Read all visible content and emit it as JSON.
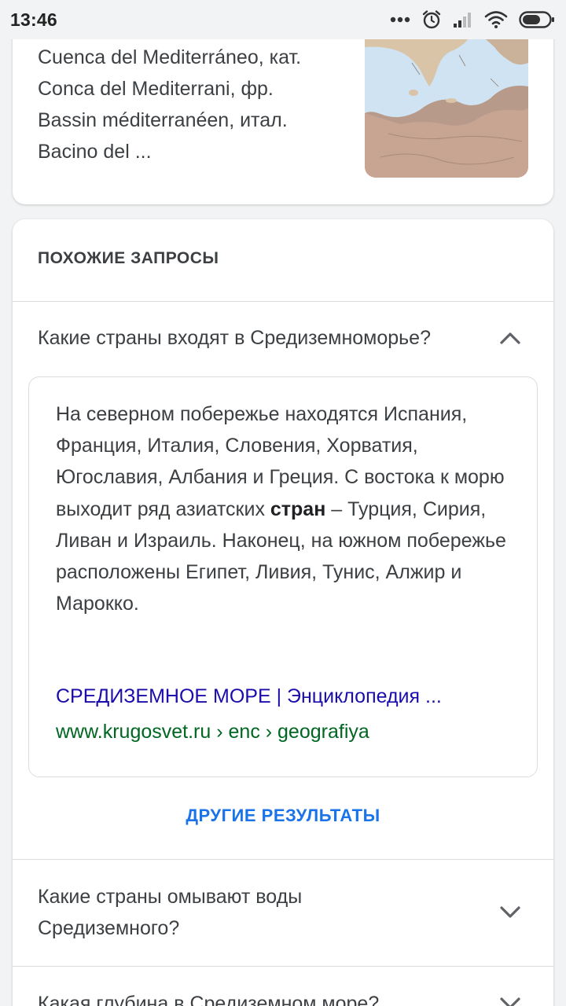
{
  "status_bar": {
    "time": "13:46",
    "icons": [
      "more-dots-icon",
      "alarm-icon",
      "signal-icon",
      "wifi-icon",
      "battery-icon"
    ]
  },
  "snippet": {
    "lines": [
      "Cuenca del Mediterráneo, кат.",
      "Conca del Mediterrani, фр.",
      "Bassin méditerranéen, итал.",
      "Bacino del ..."
    ],
    "image": "map-thumbnail"
  },
  "related": {
    "header": "ПОХОЖИЕ ЗАПРОСЫ",
    "expanded_question": "Какие страны входят в Средиземноморье?",
    "answer": {
      "before_bold": "На северном побережье находятся Испания, Франция, Италия, Словения, Хорватия, Югославия, Албания и Греция. С востока к морю выходит ряд азиатских ",
      "bold": "стран",
      "after_bold": " – Турция, Сирия, Ливан и Израиль. Наконец, на южном побережье расположены Египет, Ливия, Тунис, Алжир и Марокко."
    },
    "source_title": "СРЕДИЗЕМНОЕ МОРЕ | Энциклопедия ...",
    "source_url": "www.krugosvet.ru › enc › geografiya",
    "more_results": "ДРУГИЕ РЕЗУЛЬТАТЫ",
    "questions": [
      {
        "line1": "Какие страны омывают воды",
        "line2": "Средиземного?"
      },
      {
        "line1": "Какая глубина в Средиземном море?"
      }
    ]
  },
  "colors": {
    "link": "#1a0dab",
    "url": "#006621",
    "accent": "#1a73e8",
    "text": "#3c4043"
  }
}
